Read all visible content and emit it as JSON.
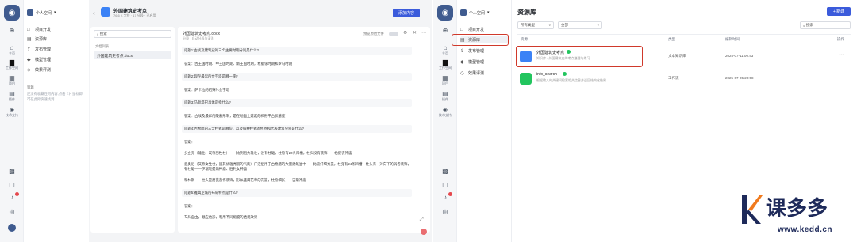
{
  "rail": {
    "items": [
      "主页",
      "工作空间",
      "项目",
      "插件",
      "技术支持"
    ]
  },
  "left_nav": {
    "workspace": "个人空间",
    "items": [
      "项目开发",
      "资源库",
      "发布管理",
      "模型管理",
      "效果评测"
    ],
    "res_title": "资源",
    "res_note": "还没有收藏任何内容,点击卡片星标即可在此处快速找到"
  },
  "doc": {
    "title": "外国建筑史考点",
    "meta": "76.6 K 字符 · 17 分段 · 已启用",
    "add_button": "添加内容",
    "search_placeholder": "搜索",
    "all_docs": "文档列表",
    "file_item": "外国建筑史考点.docx",
    "file_header": "外国建筑史考点.docx",
    "file_sub": "分段  · 自动分段与清洗",
    "toggle_label": "预览原始文件",
    "qa": [
      {
        "t": "q",
        "text": "问题1:古埃及建筑史的三个主要时期分别是什么?"
      },
      {
        "t": "a",
        "text": "答案：古王国时期、中王国时期、新王国时期，希腊化时期和罗马时期"
      },
      {
        "t": "q",
        "text": "问题2:现存最早的金字塔是哪一座?"
      },
      {
        "t": "a",
        "text": "答案：萨卡拉的昭赛尔金字塔"
      },
      {
        "t": "q",
        "text": "问题3:马斯塔巴具体是指什么?"
      },
      {
        "t": "a",
        "text": "答案：古埃及最早的陵墓形制，是在地面上建起的梯形平台状墓室"
      },
      {
        "t": "q",
        "text": "问题4:古希腊的三大柱式是哪些，以及每种柱式的特点和代表建筑分别是什么?"
      },
      {
        "t": "a",
        "text": "答案："
      },
      {
        "t": "a",
        "text": "多立克（雄壮、又称男性柱）——比例粗大雄壮，没有柱础，柱身有20条凹槽，柱头没有装饰——帕提农神庙"
      },
      {
        "t": "a",
        "text": "爱奥尼（又称女性柱，因其优雅秀丽的气质）广泛使用于古希腊的大量建筑当中——比较纤细秀美，柱身有24条凹槽，柱头有一对向下的涡卷装饰，有柱础——伊瑞克提翁神庙、胜利女神庙"
      },
      {
        "t": "a",
        "text": "科林斯——柱头是用茛苕作装饰，形似盛满花草的花篮，柱身细长——宙斯神庙"
      },
      {
        "t": "q",
        "text": "问题5:雅典卫城的布局特点是什么?"
      },
      {
        "t": "a",
        "text": "答案："
      },
      {
        "t": "a",
        "text": "布局自由，顺应地形，利用不同角度的透视效果"
      }
    ]
  },
  "resource": {
    "title": "资源库",
    "new_button": "+ 新建",
    "filter_type": "所有类型",
    "filter_all": "全部",
    "search_placeholder": "搜索",
    "headers": [
      "资源",
      "类型",
      "编辑时间",
      "操作"
    ],
    "rows": [
      {
        "name": "外国建筑史考点",
        "desc": "知识库 · 外国建筑史的考点整理与练习",
        "type": "文本知识库",
        "time": "2025-07-11 00:43"
      },
      {
        "name": "info_search",
        "desc": "根据输入的关键词检索相关信息并返回结构化结果",
        "type": "工作流",
        "time": "2025-07-05 20:58"
      }
    ]
  },
  "watermark": {
    "brand": "课多多",
    "url": "www.kedd.cn"
  }
}
